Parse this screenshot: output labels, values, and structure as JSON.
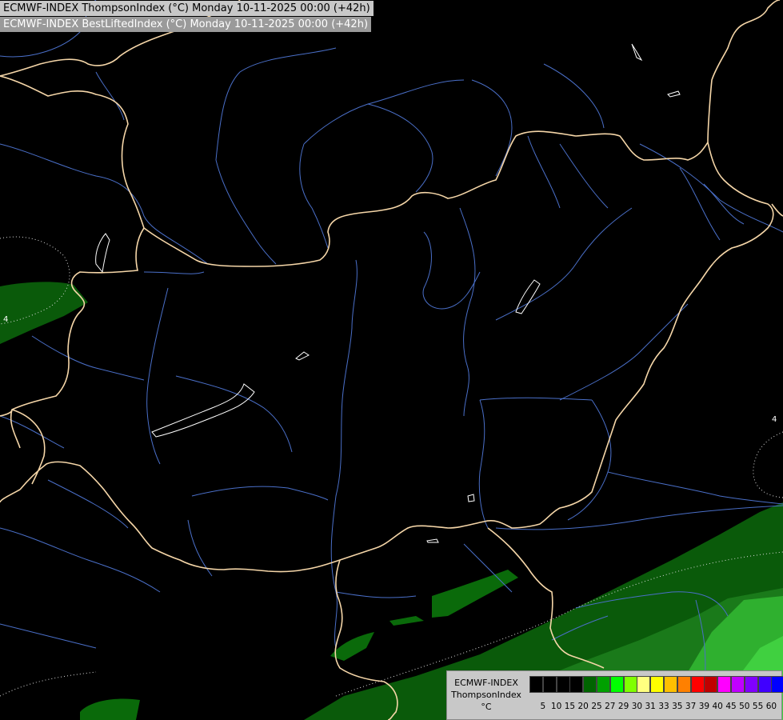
{
  "header": {
    "line1": "ECMWF-INDEX ThompsonIndex (°C) Monday 10-11-2025 00:00 (+42h)",
    "line2": "ECMWF-INDEX BestLiftedIndex (°C) Monday 10-11-2025 00:00 (+42h)"
  },
  "contour_labels": [
    {
      "text": "4",
      "label": "west-contour-label"
    },
    {
      "text": "4",
      "label": "east-contour-label"
    }
  ],
  "legend": {
    "title_model": "ECMWF-INDEX",
    "title_param": "ThompsonIndex",
    "title_unit": "°C",
    "colors": [
      "#000000",
      "#000000",
      "#000000",
      "#000000",
      "#006400",
      "#00a000",
      "#00ff00",
      "#80ff00",
      "#ffff80",
      "#ffff00",
      "#ffc000",
      "#ff8000",
      "#ff0000",
      "#c00000",
      "#ff00ff",
      "#c000ff",
      "#8000ff",
      "#4000ff",
      "#0000ff"
    ],
    "ticks": [
      "5",
      "10",
      "15",
      "20",
      "25",
      "27",
      "29",
      "30",
      "31",
      "33",
      "35",
      "37",
      "39",
      "40",
      "45",
      "50",
      "55",
      "60"
    ]
  },
  "colors": {
    "background": "#000000",
    "border": "#f5d6a8",
    "river": "#4a6fc8",
    "lake": "#ffffff",
    "field_dark": "#0a5a0a",
    "field_mid": "#1e8c1e",
    "field_light": "#3cc83c"
  }
}
